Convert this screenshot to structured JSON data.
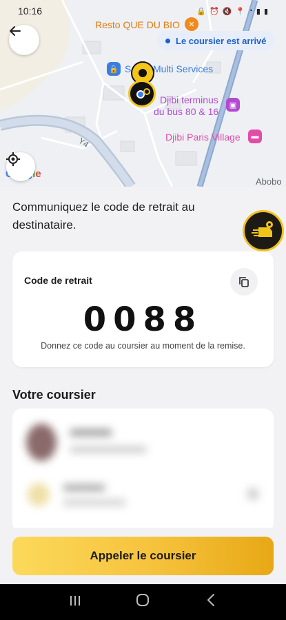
{
  "status_bar": {
    "time": "10:16"
  },
  "map": {
    "status_pill": "Le coursier est arrivé",
    "labels": {
      "resto": "Resto QUE DU BIO",
      "multi_services": "Multi Services",
      "multi_services_prefix": "S",
      "terminus_line1": "Djibi terminus",
      "terminus_line2": "du bus 80 & 16",
      "paris_village": "Djibi Paris Village",
      "road": "Y4",
      "abobo": "Abobo",
      "google": "Google"
    },
    "colors": {
      "pill_bg": "#e7eefa",
      "pill_text": "#1f5fc6",
      "poi_purple": "#b24bd0",
      "poi_pink": "#e44ba8",
      "poi_orange": "#f08a1c",
      "marker_yellow": "#f5c518"
    }
  },
  "content": {
    "instruction": "Communiquez le code de retrait au destinataire.",
    "code_card": {
      "title": "Code de retrait",
      "code": "0088",
      "hint": "Donnez ce code au coursier au moment de la remise."
    },
    "courier_section_title": "Votre coursier"
  },
  "call_button": "Appeler le coursier",
  "icons": [
    "arrow-left-icon",
    "locate-icon",
    "copy-icon",
    "delivery-icon",
    "recents-icon",
    "home-icon",
    "back-icon"
  ]
}
